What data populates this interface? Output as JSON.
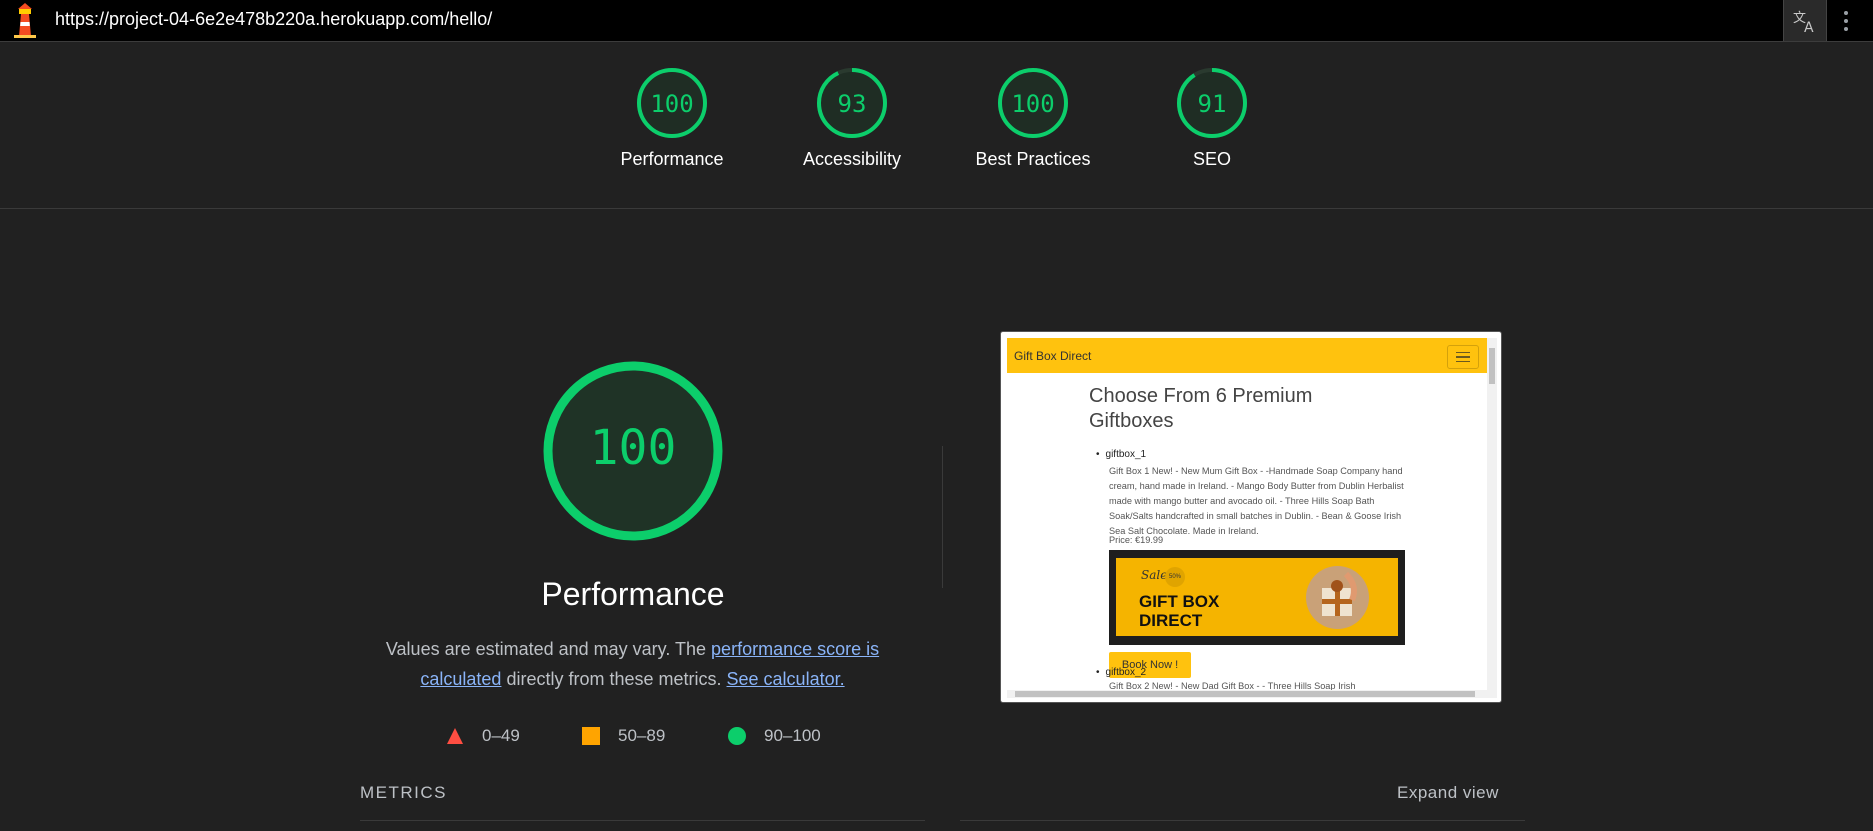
{
  "browser": {
    "url": "https://project-04-6e2e478b220a.herokuapp.com/hello/",
    "logo_icon": "lighthouse-icon",
    "translate_icon": "translate-icon",
    "menu_icon": "kebab-menu-icon"
  },
  "scores": [
    {
      "value": "100",
      "label": "Performance"
    },
    {
      "value": "93",
      "label": "Accessibility"
    },
    {
      "value": "100",
      "label": "Best Practices"
    },
    {
      "value": "91",
      "label": "SEO"
    }
  ],
  "colors": {
    "pass": "#0cce6b",
    "average": "#ffa400",
    "fail": "#ff4e42"
  },
  "performance": {
    "score": "100",
    "title": "Performance",
    "desc_prefix": "Values are estimated and may vary. The ",
    "link_score": "performance score is calculated",
    "desc_mid": " directly from these metrics. ",
    "link_calc": "See calculator.",
    "legend": [
      {
        "shape": "triangle",
        "range": "0–49"
      },
      {
        "shape": "square",
        "range": "50–89"
      },
      {
        "shape": "circle",
        "range": "90–100"
      }
    ]
  },
  "screenshot": {
    "brand": "Gift Box Direct",
    "heading": "Choose From 6 Premium Giftboxes",
    "item1_name": "giftbox_1",
    "item1_desc": "Gift Box 1 New! - New Mum Gift Box - -Handmade Soap Company hand cream, hand made in Ireland. - Mango Body Butter from Dublin Herbalist made with mango butter and avocado oil. - Three Hills Soap Bath Soak/Salts handcrafted in small batches in Dublin. - Bean & Goose Irish Sea Salt Chocolate. Made in Ireland.",
    "item1_price": "Price: €19.99",
    "banner_script": "Sale",
    "banner_badge": "50%",
    "banner_line1": "GIFT BOX",
    "banner_line2": "DIRECT",
    "book_label": "Book Now !",
    "item2_name": "giftbox_2",
    "item2_desc": "Gift Box 2 New! - New Dad Gift Box - - Three Hills Soap Irish"
  },
  "metrics": {
    "heading": "METRICS",
    "expand_label": "Expand view"
  }
}
